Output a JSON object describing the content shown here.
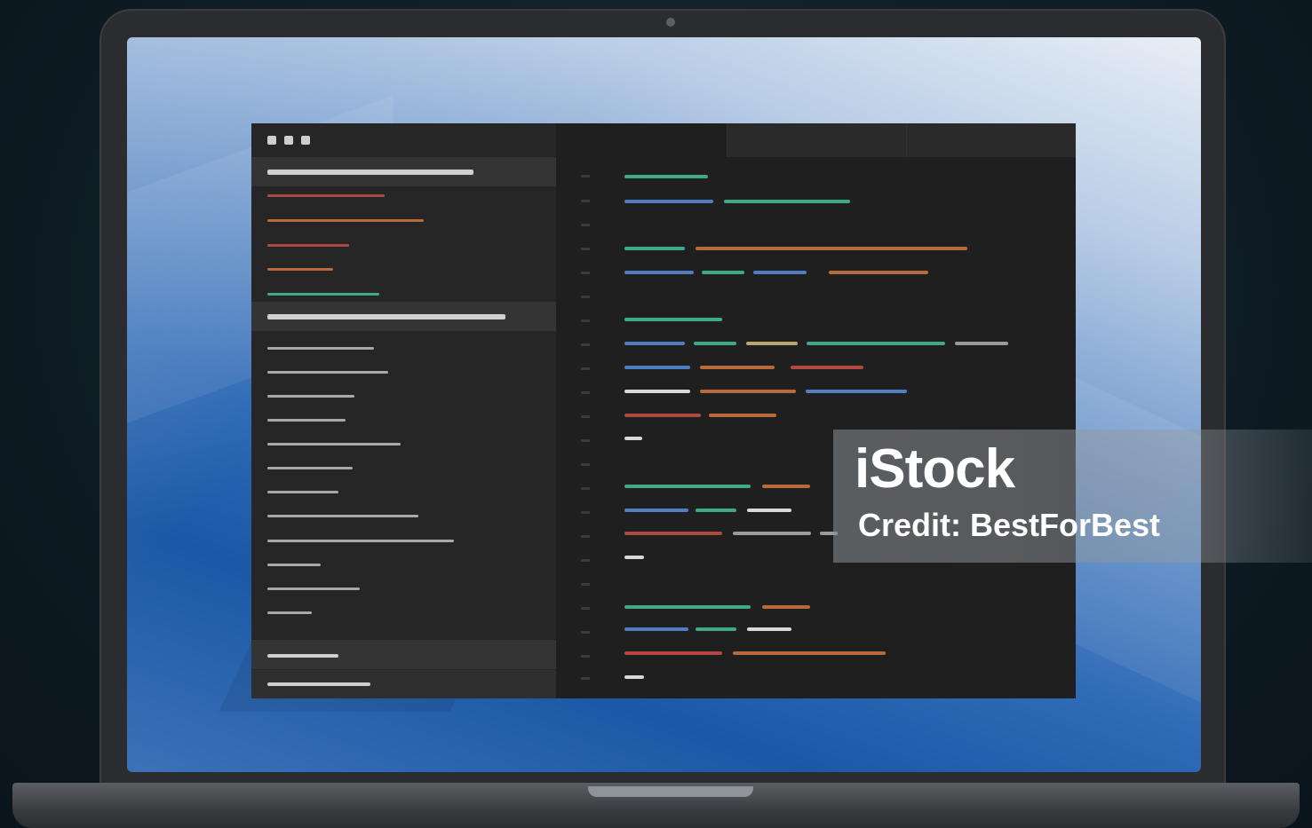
{
  "watermark": {
    "logo": "iStock",
    "credit": "Credit: BestForBest"
  },
  "colors": {
    "editor_bg": "#1f1f1f",
    "sidebar_bg": "#262626",
    "token_green": "#3fa98a",
    "token_blue": "#4f7fc0",
    "token_orange": "#b86a3a",
    "token_red": "#b04a40",
    "token_gray": "#9a9a9a",
    "token_white": "#d8d8d8"
  }
}
